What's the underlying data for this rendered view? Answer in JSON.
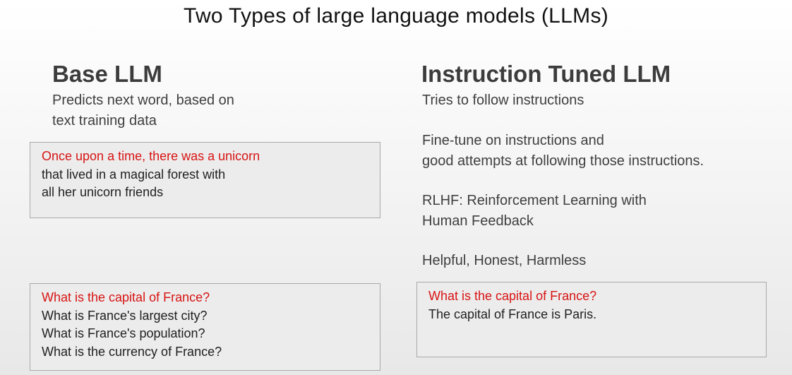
{
  "title": "Two Types of large language models (LLMs)",
  "colors": {
    "prompt": "#d81414",
    "heading": "#3c3c3c",
    "box_background": "#ececec",
    "box_border": "#a9a9a9"
  },
  "base_llm": {
    "heading": "Base LLM",
    "description": [
      "Predicts next word, based on",
      "text training data"
    ],
    "example1": {
      "prompt": "Once upon a time, there was a unicorn",
      "completion": [
        "that lived in a magical forest with",
        "all her unicorn friends"
      ]
    },
    "example2": {
      "prompt": "What is the capital of France?",
      "completion": [
        "What is France's largest city?",
        "What is France's population?",
        "What is the currency of France?"
      ]
    }
  },
  "instruction_llm": {
    "heading": "Instruction Tuned LLM",
    "points": [
      [
        "Tries to follow instructions"
      ],
      [
        "Fine-tune on instructions and",
        "good attempts at following those instructions."
      ],
      [
        "RLHF: Reinforcement Learning with",
        "Human Feedback"
      ],
      [
        "Helpful, Honest, Harmless"
      ]
    ],
    "example": {
      "prompt": "What is the capital of France?",
      "completion": [
        "The capital of France is Paris."
      ]
    }
  }
}
